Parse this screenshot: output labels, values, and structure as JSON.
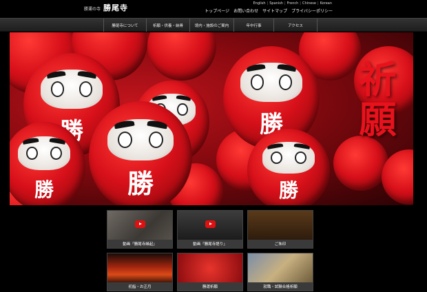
{
  "header": {
    "logo_sub": "勝運の寺",
    "logo_main": "勝尾寺"
  },
  "languages": [
    "English",
    "Spanish",
    "French",
    "Chinese",
    "Korean"
  ],
  "util_nav": [
    "トップページ",
    "お問い合わせ",
    "サイトマップ",
    "プライバシーポリシー"
  ],
  "global_nav": [
    "勝尾寺について",
    "祈願・供養・納骨",
    "境内・施設のご案内",
    "年中行事",
    "アクセス"
  ],
  "hero": {
    "title": "祈願",
    "daruma_kanji": "勝"
  },
  "tiles": [
    {
      "label": "動画「勝尾寺縁起」",
      "has_play": true
    },
    {
      "label": "動画「勝尾寺語り」",
      "has_play": true
    },
    {
      "label": "ご朱印",
      "has_play": false
    },
    {
      "label": "初詣・お正月",
      "has_play": false
    },
    {
      "label": "勝運祈願",
      "has_play": false
    },
    {
      "label": "就職・試験合格祈願",
      "has_play": false
    }
  ],
  "colors": {
    "background": "#000000",
    "accent_red": "#e8121c",
    "nav_bg": "#2a2a2a"
  }
}
